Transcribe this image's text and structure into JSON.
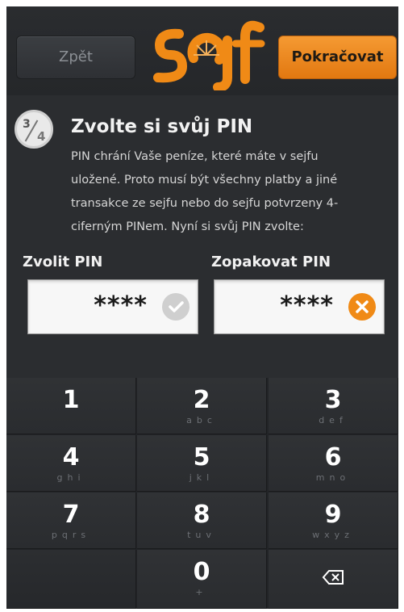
{
  "header": {
    "back_label": "Zpět",
    "next_label": "Pokračovat",
    "logo_text": "sejf"
  },
  "step": {
    "current": "3",
    "total": "4",
    "title": "Zvolte si svůj PIN",
    "description": "PIN chrání Vaše peníze, které máte v sejfu uložené. Proto musí být všechny platby a jiné transakce ze sejfu nebo do sejfu potvrzeny 4-ciferným PINem. Nyní si svůj PIN zvolte:"
  },
  "pin": {
    "choose_label": "Zvolit PIN",
    "choose_value": "****",
    "choose_status": "valid",
    "repeat_label": "Zopakovat PIN",
    "repeat_value": "****",
    "repeat_status": "invalid"
  },
  "keypad": [
    {
      "digit": "1",
      "letters": ""
    },
    {
      "digit": "2",
      "letters": "abc"
    },
    {
      "digit": "3",
      "letters": "def"
    },
    {
      "digit": "4",
      "letters": "ghi"
    },
    {
      "digit": "5",
      "letters": "jkl"
    },
    {
      "digit": "6",
      "letters": "mno"
    },
    {
      "digit": "7",
      "letters": "pqrs"
    },
    {
      "digit": "8",
      "letters": "tuv"
    },
    {
      "digit": "9",
      "letters": "wxyz"
    },
    {
      "digit": "",
      "letters": ""
    },
    {
      "digit": "0",
      "letters": "+"
    },
    {
      "digit": "backspace-icon",
      "letters": ""
    }
  ],
  "colors": {
    "accent": "#f08a16",
    "background": "#2b2d30",
    "valid_icon": "#cfcfcf"
  }
}
